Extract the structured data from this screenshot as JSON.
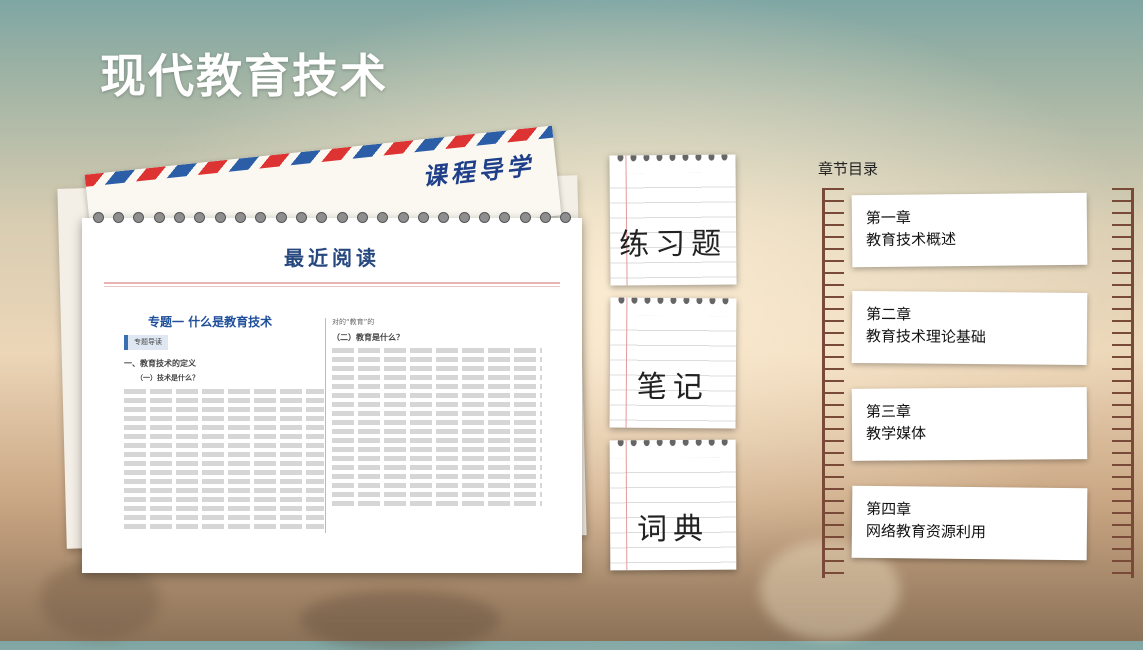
{
  "page_title": "现代教育技术",
  "airmail_label": "课程导学",
  "reading": {
    "heading": "最近阅读",
    "left_topic": "专题一  什么是教育技术",
    "left_tag": "专题导读",
    "left_section1": "一、教育技术的定义",
    "left_sub1": "（一）技术是什么？",
    "right_intro": "对的“教育”的",
    "right_section": "（二）教育是什么？"
  },
  "notes": [
    {
      "label": "练习题"
    },
    {
      "label": "笔记"
    },
    {
      "label": "词典"
    }
  ],
  "toc": {
    "title": "章节目录",
    "chapters": [
      {
        "number": "第一章",
        "name": "教育技术概述"
      },
      {
        "number": "第二章",
        "name": "教育技术理论基础"
      },
      {
        "number": "第三章",
        "name": "教学媒体"
      },
      {
        "number": "第四章",
        "name": "网络教育资源利用"
      }
    ]
  }
}
